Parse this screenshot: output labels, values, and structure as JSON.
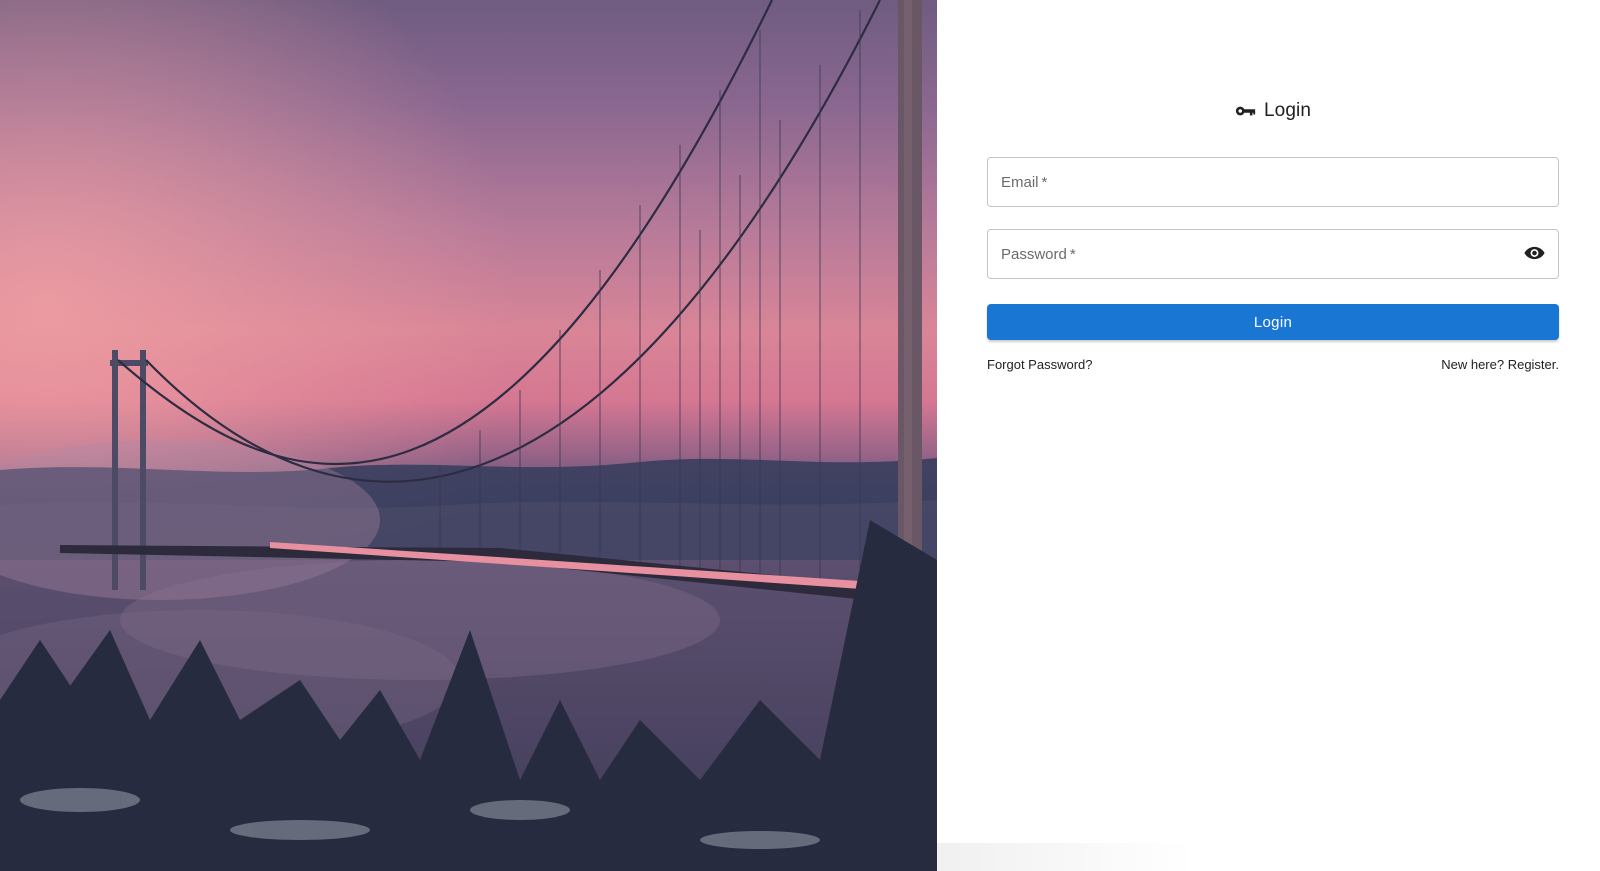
{
  "background": {
    "description_icon": "photo-icon",
    "colors": {
      "sky_top": "#6f5c80",
      "sky_pink": "#d98597",
      "water": "#4c4662",
      "trees": "#2f3349"
    }
  },
  "login": {
    "title": "Login",
    "title_icon": "key-icon",
    "email": {
      "label": "Email",
      "required_mark": "*",
      "value": ""
    },
    "password": {
      "label": "Password",
      "required_mark": "*",
      "value": "",
      "toggle_icon": "eye-icon"
    },
    "submit_label": "Login",
    "forgot_link": "Forgot Password?",
    "register_link": "New here? Register."
  },
  "colors": {
    "primary": "#1976d2",
    "text": "#202124",
    "border": "#c4c4c4"
  }
}
